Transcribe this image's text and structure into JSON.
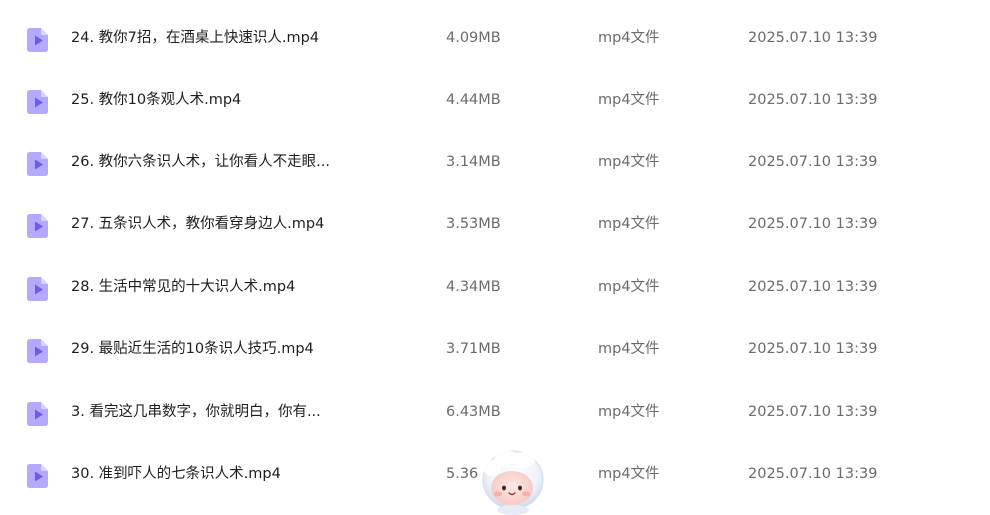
{
  "files": [
    {
      "name": "24. 教你7招，在酒桌上快速识人.mp4",
      "size": "4.09MB",
      "type": "mp4文件",
      "date": "2025.07.10 13:39",
      "icon": "video-file-icon"
    },
    {
      "name": "25. 教你10条观人术.mp4",
      "size": "4.44MB",
      "type": "mp4文件",
      "date": "2025.07.10 13:39",
      "icon": "video-file-icon"
    },
    {
      "name": "26. 教你六条识人术，让你看人不走眼...",
      "size": "3.14MB",
      "type": "mp4文件",
      "date": "2025.07.10 13:39",
      "icon": "video-file-icon"
    },
    {
      "name": "27. 五条识人术，教你看穿身边人.mp4",
      "size": "3.53MB",
      "type": "mp4文件",
      "date": "2025.07.10 13:39",
      "icon": "video-file-icon"
    },
    {
      "name": "28. 生活中常见的十大识人术.mp4",
      "size": "4.34MB",
      "type": "mp4文件",
      "date": "2025.07.10 13:39",
      "icon": "video-file-icon"
    },
    {
      "name": "29. 最贴近生活的10条识人技巧.mp4",
      "size": "3.71MB",
      "type": "mp4文件",
      "date": "2025.07.10 13:39",
      "icon": "video-file-icon"
    },
    {
      "name": "3. 看完这几串数字，你就明白，你有...",
      "size": "6.43MB",
      "type": "mp4文件",
      "date": "2025.07.10 13:39",
      "icon": "video-file-icon"
    },
    {
      "name": "30. 准到吓人的七条识人术.mp4",
      "size": "5.36",
      "type": "mp4文件",
      "date": "2025.07.10 13:39",
      "icon": "video-file-icon"
    }
  ],
  "colors": {
    "icon_light": "#b9b3ff",
    "icon_dark": "#7a6cf2",
    "text_primary": "#1e1e1e",
    "text_secondary": "#6b6b6b"
  },
  "mascot": {
    "icon": "assistant-mascot-icon"
  }
}
